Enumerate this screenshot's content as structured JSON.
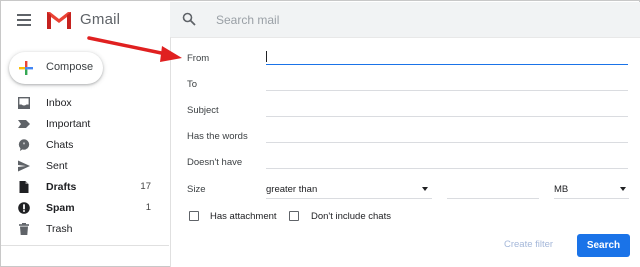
{
  "app": {
    "name": "Gmail",
    "accent": "#1a73e8",
    "logo_red": "#ea4335"
  },
  "header": {
    "menu_icon": "hamburger-menu-icon",
    "search_icon": "search-icon",
    "search_placeholder": "Search mail"
  },
  "sidebar": {
    "compose_label": "Compose",
    "items": [
      {
        "label": "Inbox",
        "icon": "inbox-icon",
        "count": "",
        "bold": false
      },
      {
        "label": "Important",
        "icon": "important-label-icon",
        "count": "",
        "bold": false
      },
      {
        "label": "Chats",
        "icon": "chat-bubble-icon",
        "count": "",
        "bold": false
      },
      {
        "label": "Sent",
        "icon": "send-icon",
        "count": "",
        "bold": false
      },
      {
        "label": "Drafts",
        "icon": "draft-icon",
        "count": "17",
        "bold": true
      },
      {
        "label": "Spam",
        "icon": "spam-icon",
        "count": "1",
        "bold": true
      },
      {
        "label": "Trash",
        "icon": "trash-icon",
        "count": "",
        "bold": false
      }
    ]
  },
  "advanced_search": {
    "from_label": "From",
    "from_value": "",
    "to_label": "To",
    "to_value": "",
    "subject_label": "Subject",
    "subject_value": "",
    "has_words_label": "Has the words",
    "has_words_value": "",
    "doesnt_have_label": "Doesn't have",
    "doesnt_have_value": "",
    "size_label": "Size",
    "size_operator": "greater than",
    "size_value": "",
    "size_unit": "MB",
    "has_attachment_label": "Has attachment",
    "has_attachment_checked": false,
    "dont_include_chats_label": "Don't include chats",
    "dont_include_chats_checked": false,
    "create_filter_label": "Create filter",
    "search_button_label": "Search"
  },
  "annotation": {
    "arrow_color": "#e02020",
    "points_to": "From field"
  }
}
